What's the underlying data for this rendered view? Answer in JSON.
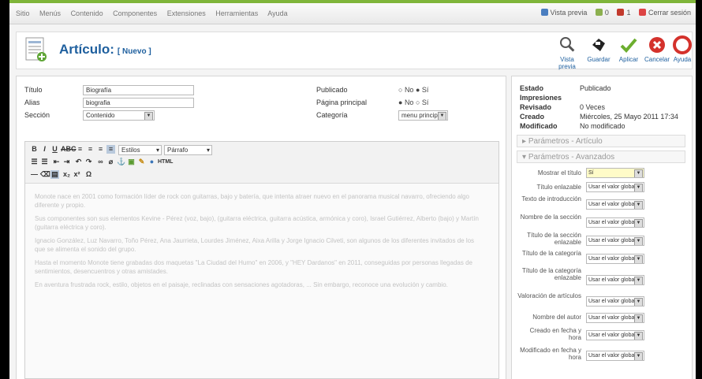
{
  "menu": [
    "Sitio",
    "Menús",
    "Contenido",
    "Componentes",
    "Extensiones",
    "Herramientas",
    "Ayuda"
  ],
  "status": {
    "preview": "Vista previa",
    "messages": "0",
    "users": "1",
    "logout": "Cerrar sesión"
  },
  "header": {
    "title": "Artículo:",
    "subtitle": "[ Nuevo ]"
  },
  "toolbar": {
    "preview": "Vista previa",
    "save": "Guardar",
    "apply": "Aplicar",
    "cancel": "Cancelar",
    "help": "Ayuda"
  },
  "form": {
    "title_label": "Título",
    "title_value": "Biografía",
    "alias_label": "Alias",
    "alias_value": "biografia",
    "section_label": "Sección",
    "section_value": "Contenido",
    "published_label": "Publicado",
    "published_no": "No",
    "published_yes": "Sí",
    "frontpage_label": "Página principal",
    "frontpage_no": "No",
    "frontpage_yes": "Sí",
    "category_label": "Categoría",
    "category_value": "menu principal"
  },
  "editor": {
    "styles": "Estilos",
    "format": "Párrafo",
    "paragraphs": [
      "Monote nace en 2001 como formación líder de rock con guitarras, bajo y batería, que intenta atraer nuevo en el panorama musical navarro, ofreciendo algo diferente y propio.",
      "Sus componentes son sus elementos Kevine - Pérez (voz, bajo), (guitarra eléctrica, guitarra acústica, armónica y coro), Israel Gutiérrez, Alberto (bajo) y Martín (guitarra eléctrica y coro).",
      "Ignacio González, Luz Navarro, Toño Pérez, Ana Jaurrieta, Lourdes Jiménez, Aixa Arilla y Jorge Ignacio Cilveti, son algunos de los diferentes invitados de los que se alimenta el sonido del grupo.",
      "Hasta el momento Monote tiene grabadas dos maquetas \"La Ciudad del Humo\" en 2006, y \"HEY Dardanos\" en 2011, conseguidas por personas llegadas de sentimientos, desencuentros y otras amistades.",
      "En aventura frustrada rock, estilo, objetos en el paisaje, reclinadas con sensaciones agotadoras, ... Sin embargo, reconoce una evolución y cambio."
    ]
  },
  "info": {
    "estado_label": "Estado",
    "estado_value": "Publicado",
    "impresiones_label": "Impresiones",
    "revisado_label": "Revisado",
    "revisado_value": "0 Veces",
    "creado_label": "Creado",
    "creado_value": "Miércoles, 25 Mayo 2011 17:34",
    "modificado_label": "Modificado",
    "modificado_value": "No modificado"
  },
  "params": {
    "article_header": "Parámetros - Artículo",
    "advanced_header": "Parámetros - Avanzados",
    "rows": [
      {
        "label": "Mostrar el título",
        "value": "Sí"
      },
      {
        "label": "Título enlazable",
        "value": "Usar el valor global"
      },
      {
        "label": "Texto de introducción",
        "value": "Usar el valor global"
      },
      {
        "label": "Nombre de la sección",
        "value": "Usar el valor global"
      },
      {
        "label": "Título de la sección enlazable",
        "value": "Usar el valor global"
      },
      {
        "label": "Título de la categoría",
        "value": "Usar el valor global"
      },
      {
        "label": "Título de la categoría enlazable",
        "value": "Usar el valor global"
      },
      {
        "label": "Valoración de artículos",
        "value": "Usar el valor global"
      },
      {
        "label": "Nombre del autor",
        "value": "Usar el valor global"
      },
      {
        "label": "Creado en fecha y hora",
        "value": "Usar el valor global"
      },
      {
        "label": "Modificado en fecha y hora",
        "value": "Usar el valor global"
      }
    ]
  }
}
